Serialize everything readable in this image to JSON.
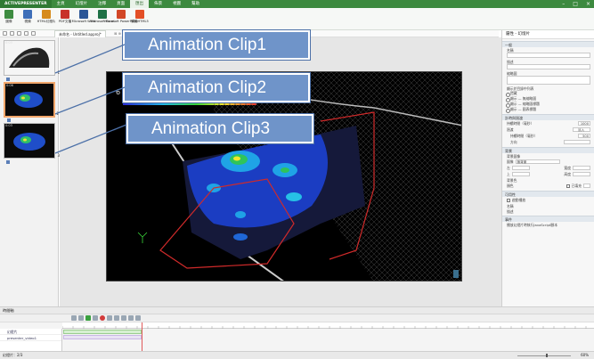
{
  "app": {
    "name": "ACTIVEPRESENTER"
  },
  "menu": [
    "主頁",
    "幻燈片",
    "注釋",
    "頁面",
    "匯出",
    "佈景",
    "視圖",
    "幫助"
  ],
  "menu_active_index": 4,
  "ribbon": [
    {
      "label": "圖像",
      "icon": "image-export-icon",
      "color": "#3d8c40"
    },
    {
      "label": "視頻",
      "icon": "video-export-icon",
      "color": "#3d6fb8"
    },
    {
      "label": "HTML幻燈片",
      "icon": "html-slides-icon",
      "color": "#d68a1a"
    },
    {
      "label": "PDF文檔",
      "icon": "pdf-icon",
      "color": "#c8322a"
    },
    {
      "label": "Microsoft Word",
      "icon": "word-icon",
      "color": "#2b5797"
    },
    {
      "label": "Microsoft Excel",
      "icon": "excel-icon",
      "color": "#1e7145"
    },
    {
      "label": "Microsoft PowerPoint",
      "icon": "powerpoint-icon",
      "color": "#d24726"
    },
    {
      "label": "模擬HTML5",
      "icon": "html5-icon",
      "color": "#e34f26"
    }
  ],
  "doc_tab": "未命名 - Untitled.approj*",
  "slides": [
    {
      "time": "0:03",
      "number": "1"
    },
    {
      "time": "0:06",
      "number": "2"
    },
    {
      "time": "0:03",
      "number": "3"
    }
  ],
  "callouts": [
    "Animation Clip1",
    "Animation Clip2",
    "Animation Clip3"
  ],
  "right_panel": {
    "title": "屬性 - 幻燈片",
    "general_header": "一般",
    "name_label": "名稱",
    "notes_label": "描述",
    "tags_label": "縮略圖",
    "show_in_toc_label": "顯示於目錄中列表",
    "radios": [
      "隱藏",
      "顯示 — 無縮略圖",
      "顯示 — 縮略圖標題",
      "顯示 — 圖表標題"
    ],
    "timing_header": "計時與過渡",
    "duration_label": "持續時間（毫秒）",
    "duration_value": "1000",
    "transition_label": "過渡",
    "transition_btn": "淡入",
    "transition_duration_label": "持續時間（毫秒）",
    "transition_duration_value": "500",
    "direction_label": "方向",
    "background_header": "背景",
    "bg_label": "背景圖像",
    "bg_image_label": "圖像",
    "bg_image_value": "無背景",
    "left_label": "左",
    "top_label": "上",
    "width_label": "寬度",
    "height_label": "高度",
    "bg_color_label": "背景色",
    "color_label": "顏色",
    "color_checkbox": "已填充",
    "interaction_header": "可用性",
    "enabled_label": "啟動播放",
    "prop_a": "名稱",
    "prop_b": "描述",
    "events_header": "事件",
    "events_text": "播放幻燈片時執行JavaScript腳本"
  },
  "timeline": {
    "header": "時間軸",
    "rows": [
      "幻燈片",
      "presenter_video1"
    ]
  },
  "status": {
    "slide": "幻燈片：2/3",
    "zoom": "60%"
  }
}
